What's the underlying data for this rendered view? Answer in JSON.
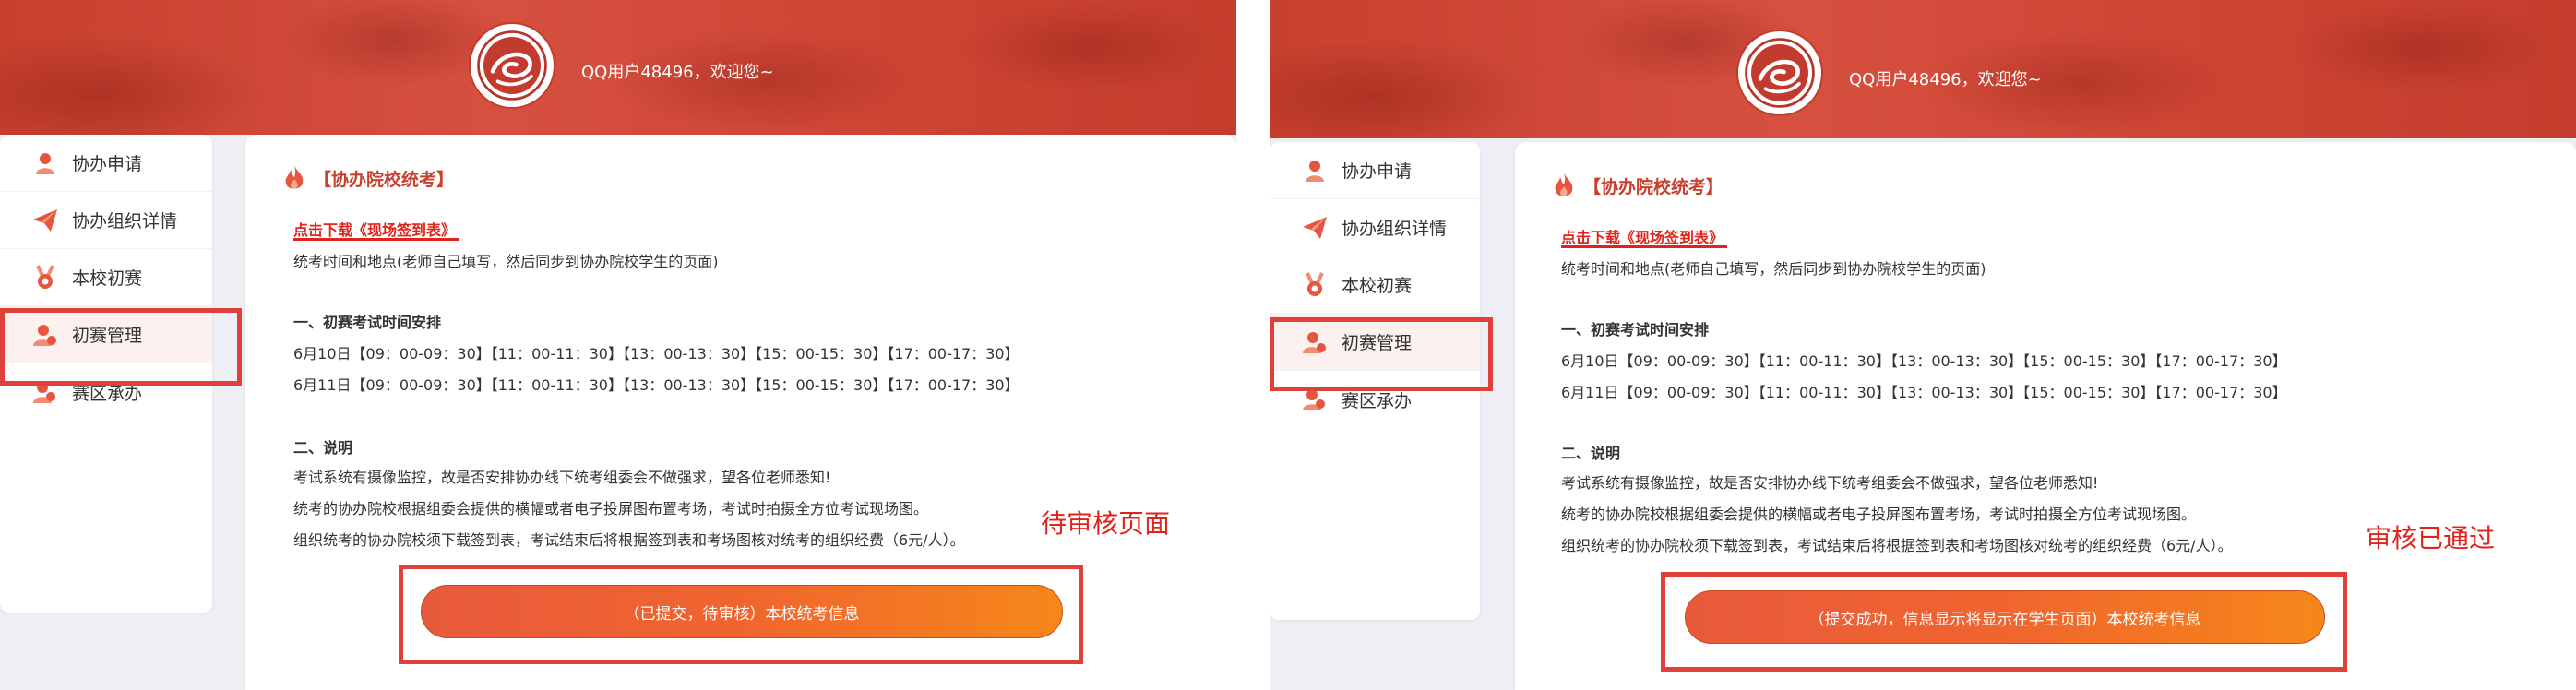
{
  "colors": {
    "brand_red": "#c8402e",
    "link_red": "#e0241b",
    "button_gradient": [
      "#e85a3c",
      "#f7871a"
    ],
    "page_bg": "#eeeff5",
    "highlight_box": "#e0403a"
  },
  "panels": [
    {
      "user": {
        "greeting": "QQ用户48496，欢迎您~"
      },
      "sidebar": {
        "items": [
          {
            "label": "协办申请",
            "icon": "user-icon",
            "active": false
          },
          {
            "label": "协办组织详情",
            "icon": "paper-plane-icon",
            "active": false
          },
          {
            "label": "本校初赛",
            "icon": "medal-icon",
            "active": false
          },
          {
            "label": "初赛管理",
            "icon": "user-manage-icon",
            "active": true
          },
          {
            "label": "赛区承办",
            "icon": "user-group-icon",
            "active": false
          }
        ]
      },
      "main": {
        "title": "【协办院校统考】",
        "download_prefix": "点击下载",
        "download_link": "《现场签到表》",
        "intro": "统考时间和地点(老师自己填写，然后同步到协办院校学生的页面)",
        "schedule_heading": "一、初赛考试时间安排",
        "schedule": [
          "6月10日【09：00-09：30】【11：00-11：30】【13：00-13：30】【15：00-15：30】【17：00-17：30】",
          "6月11日【09：00-09：30】【11：00-11：30】【13：00-13：30】【15：00-15：30】【17：00-17：30】"
        ],
        "notes_heading": "二、说明",
        "notes": [
          "考试系统有摄像监控，故是否安排协办线下统考组委会不做强求，望各位老师悉知!",
          "统考的协办院校根据组委会提供的横幅或者电子投屏图布置考场，考试时拍摄全方位考试现场图。",
          "组织统考的协办院校须下载签到表，考试结束后将根据签到表和考场图核对统考的组织经费（6元/人）。"
        ],
        "submit_label": "（已提交，待审核）本校统考信息"
      },
      "annotation": "待审核页面"
    },
    {
      "user": {
        "greeting": "QQ用户48496，欢迎您~"
      },
      "sidebar": {
        "items": [
          {
            "label": "协办申请",
            "icon": "user-icon",
            "active": false
          },
          {
            "label": "协办组织详情",
            "icon": "paper-plane-icon",
            "active": false
          },
          {
            "label": "本校初赛",
            "icon": "medal-icon",
            "active": false
          },
          {
            "label": "初赛管理",
            "icon": "user-manage-icon",
            "active": true
          },
          {
            "label": "赛区承办",
            "icon": "user-group-icon",
            "active": false
          }
        ]
      },
      "main": {
        "title": "【协办院校统考】",
        "download_prefix": "点击下载",
        "download_link": "《现场签到表》",
        "intro": "统考时间和地点(老师自己填写，然后同步到协办院校学生的页面)",
        "schedule_heading": "一、初赛考试时间安排",
        "schedule": [
          "6月10日【09：00-09：30】【11：00-11：30】【13：00-13：30】【15：00-15：30】【17：00-17：30】",
          "6月11日【09：00-09：30】【11：00-11：30】【13：00-13：30】【15：00-15：30】【17：00-17：30】"
        ],
        "notes_heading": "二、说明",
        "notes": [
          "考试系统有摄像监控，故是否安排协办线下统考组委会不做强求，望各位老师悉知!",
          "统考的协办院校根据组委会提供的横幅或者电子投屏图布置考场，考试时拍摄全方位考试现场图。",
          "组织统考的协办院校须下载签到表，考试结束后将根据签到表和考场图核对统考的组织经费（6元/人）。"
        ],
        "submit_label": "（提交成功，信息显示将显示在学生页面）本校统考信息"
      },
      "annotation": "审核已通过"
    }
  ]
}
